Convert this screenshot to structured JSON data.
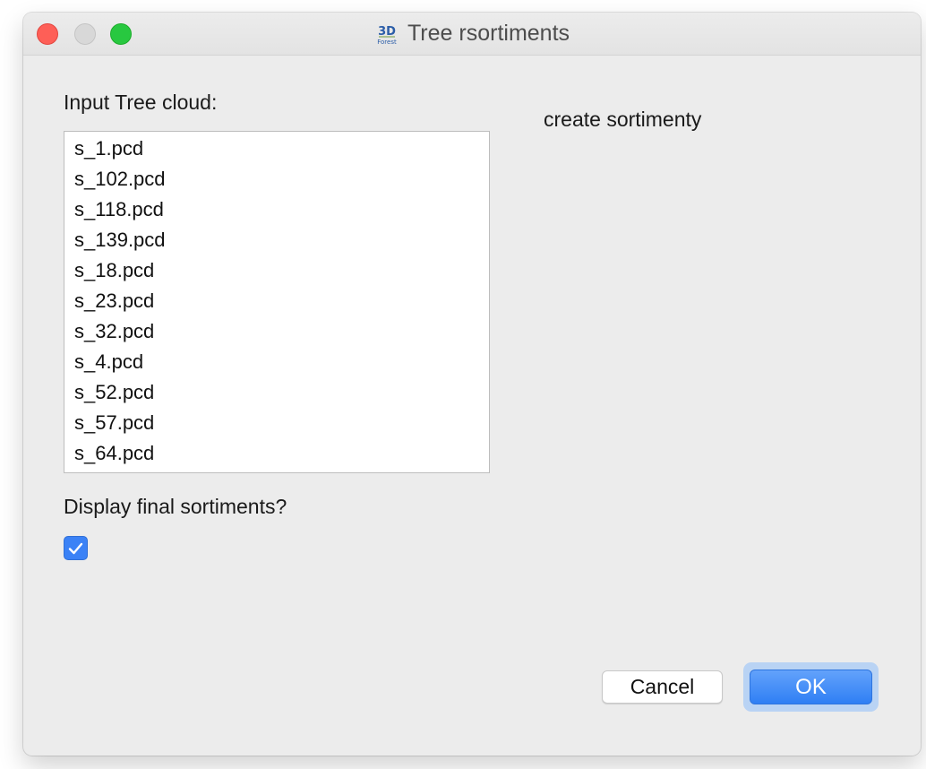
{
  "window": {
    "title": "Tree rsortiments",
    "app_icon": "3d-forest-logo-icon",
    "app_icon_text_top": "3D",
    "app_icon_text_bottom": "Forest"
  },
  "input_section": {
    "label": "Input Tree cloud:",
    "items": [
      "s_1.pcd",
      "s_102.pcd",
      "s_118.pcd",
      "s_139.pcd",
      "s_18.pcd",
      "s_23.pcd",
      "s_32.pcd",
      "s_4.pcd",
      "s_52.pcd",
      "s_57.pcd",
      "s_64.pcd"
    ]
  },
  "description": {
    "text": "create sortimenty"
  },
  "display_option": {
    "label": "Display final sortiments?",
    "checked": true
  },
  "buttons": {
    "cancel_label": "Cancel",
    "ok_label": "OK"
  },
  "colors": {
    "accent": "#3b82f6",
    "close": "#fe5f57",
    "minimize": "#d8d8d8",
    "zoom": "#28c840"
  }
}
